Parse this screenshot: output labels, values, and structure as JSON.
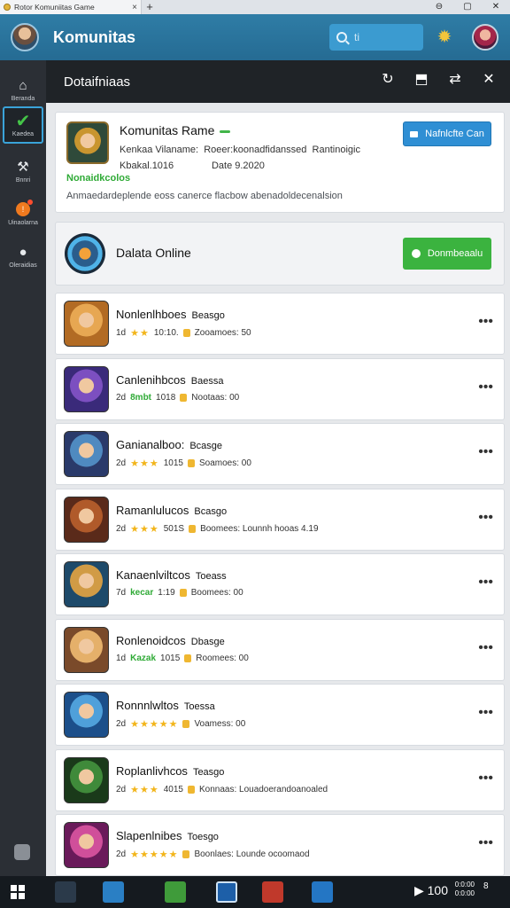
{
  "browser": {
    "tab_title": "Rotor Komuniitas Game",
    "tab_close": "×",
    "new_tab": "+",
    "controls": [
      "⊖",
      "▢",
      "✕"
    ]
  },
  "header": {
    "title": "Komunitas",
    "search_placeholder": "ti"
  },
  "sidebar": {
    "items": [
      {
        "label": "Beranda",
        "icon": "home-icon"
      },
      {
        "label": "Kaedea",
        "icon": "check-icon"
      },
      {
        "label": "Bnnri",
        "icon": "tools-icon"
      },
      {
        "label": "Uinaolarna",
        "icon": "notifications-icon"
      },
      {
        "label": "Oleraidias",
        "icon": "info-icon"
      }
    ]
  },
  "main": {
    "title": "Dotaifniaas",
    "header_icons": [
      "refresh-icon",
      "share-icon",
      "link-icon",
      "close-icon"
    ]
  },
  "community": {
    "title": "Komunitas Rame",
    "line1a": "Kenkaa Vilaname:",
    "line1b": "Roeer:koonadfidanssed",
    "line1c": "Rantinoigic",
    "line2a": "Kbakal.1016",
    "line2b": "Date 9.2020",
    "green": "Nonaidkcolos",
    "description": "Anmaedardeplende eoss canerce flacbow abenadoldecenalsion",
    "button": "Nafnlcfte Can"
  },
  "online": {
    "title": "Dalata Online",
    "button": "Donmbeaalu"
  },
  "games": [
    {
      "name": "Nonlenlhboes",
      "tag": "Beasgo",
      "rating": "1d",
      "stars": "★★",
      "extra": "10:10.",
      "stat": "Zooamoes: 50",
      "colors": [
        "#b26b24",
        "#e7a752"
      ]
    },
    {
      "name": "Canlenihbcos",
      "tag": "Baessa",
      "rating": "2d",
      "stars": "",
      "green": "8mbt",
      "extra": "1018",
      "stat": "Nootaas: 00",
      "colors": [
        "#3a2a7a",
        "#7c4fc0"
      ]
    },
    {
      "name": "Ganianalboo:",
      "tag": "Bcasge",
      "rating": "2d",
      "stars": "★★★",
      "extra": "1015",
      "stat": "Soamoes: 00",
      "colors": [
        "#2a3a6a",
        "#4f8ac0"
      ]
    },
    {
      "name": "Ramanlulucos",
      "tag": "Bcasgo",
      "rating": "2d",
      "stars": "★★★",
      "extra": "501S",
      "stat": "Boomees: Lounnh hooas 4.19",
      "colors": [
        "#5a2a1a",
        "#b05a2a"
      ]
    },
    {
      "name": "Kanaenlviltcos",
      "tag": "Toeass",
      "rating": "7d",
      "stars": "",
      "green": "kecar",
      "extra": "1:19",
      "stat": "Boomees: 00",
      "colors": [
        "#1e4a6a",
        "#d19b45"
      ]
    },
    {
      "name": "Ronlenoidcos",
      "tag": "Dbasge",
      "rating": "1d",
      "stars": "",
      "green": "Kazak",
      "extra": "1015",
      "stat": "Roomees: 00",
      "colors": [
        "#7a4a2a",
        "#e5b06a"
      ]
    },
    {
      "name": "Ronnnlwltos",
      "tag": "Toessa",
      "rating": "2d",
      "stars": "★★★★★",
      "extra": "",
      "stat": "Voamess: 00",
      "colors": [
        "#1c4f8a",
        "#4fa0da"
      ]
    },
    {
      "name": "Roplanlivhcos",
      "tag": "Teasgo",
      "rating": "2d",
      "stars": "★★★",
      "extra": "4015",
      "stat": "Konnaas: Louadoerandoanoaled",
      "colors": [
        "#1a3a1a",
        "#3f8a3a"
      ]
    },
    {
      "name": "Slapenlnibes",
      "tag": "Toesgo",
      "rating": "2d",
      "stars": "★★★★★",
      "extra": "",
      "stat": "Boonlaes: Lounde ocoomaod",
      "colors": [
        "#6a1a5a",
        "#d04f9a"
      ]
    }
  ],
  "taskbar": {
    "tray": "▶ 100",
    "clock_line1": "0:0:00",
    "clock_line2": "0:0:00",
    "notif": "8"
  }
}
